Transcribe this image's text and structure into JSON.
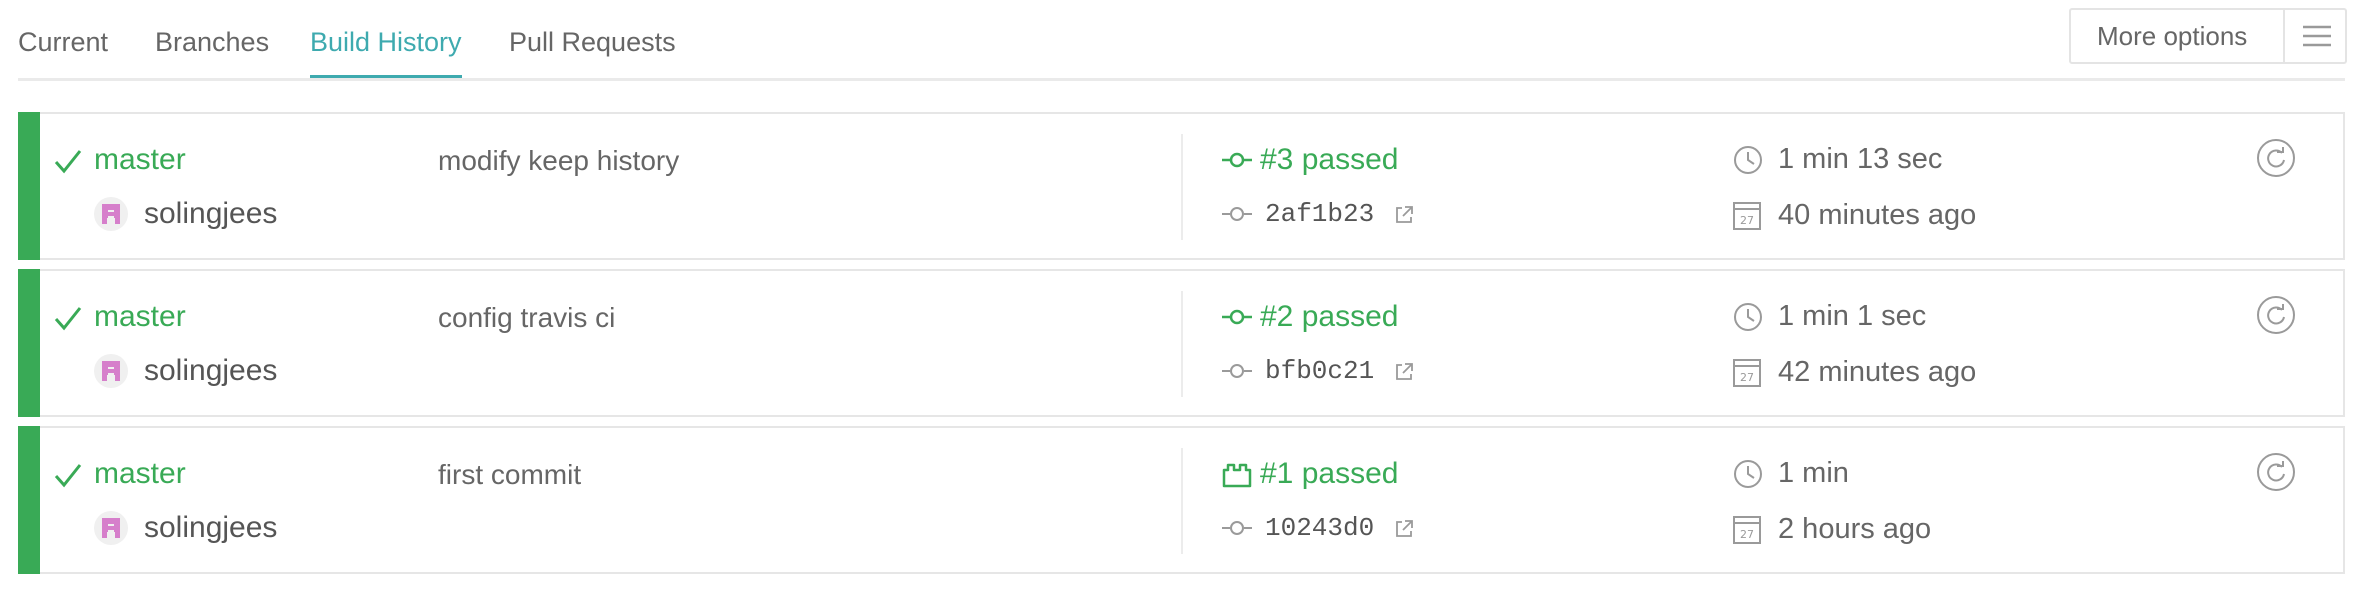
{
  "tabs": [
    {
      "label": "Current",
      "active": false
    },
    {
      "label": "Branches",
      "active": false
    },
    {
      "label": "Build History",
      "active": true
    },
    {
      "label": "Pull Requests",
      "active": false
    }
  ],
  "more_options": {
    "label": "More options",
    "icon": "menu-icon"
  },
  "colors": {
    "passed": "#39aa56",
    "active_tab": "#3eaaaf",
    "text": "#666666",
    "border": "#e6e6e6",
    "icon_gray": "#9a9a9a",
    "avatar": "#d67fcb"
  },
  "builds": [
    {
      "status": "passed",
      "status_icon": "check-icon",
      "branch": "master",
      "author": "solingjees",
      "message": "modify keep history",
      "build_icon": "commit-push-icon",
      "build_label": "#3 passed",
      "commit_sha": "2af1b23",
      "duration": "1 min 13 sec",
      "finished": "40 minutes ago"
    },
    {
      "status": "passed",
      "status_icon": "check-icon",
      "branch": "master",
      "author": "solingjees",
      "message": "config travis ci",
      "build_icon": "commit-push-icon",
      "build_label": "#2 passed",
      "commit_sha": "bfb0c21",
      "duration": "1 min 1 sec",
      "finished": "42 minutes ago"
    },
    {
      "status": "passed",
      "status_icon": "check-icon",
      "branch": "master",
      "author": "solingjees",
      "message": "first commit",
      "build_icon": "lego-build-icon",
      "build_label": "#1 passed",
      "commit_sha": "10243d0",
      "duration": "1 min",
      "finished": "2 hours ago"
    }
  ]
}
